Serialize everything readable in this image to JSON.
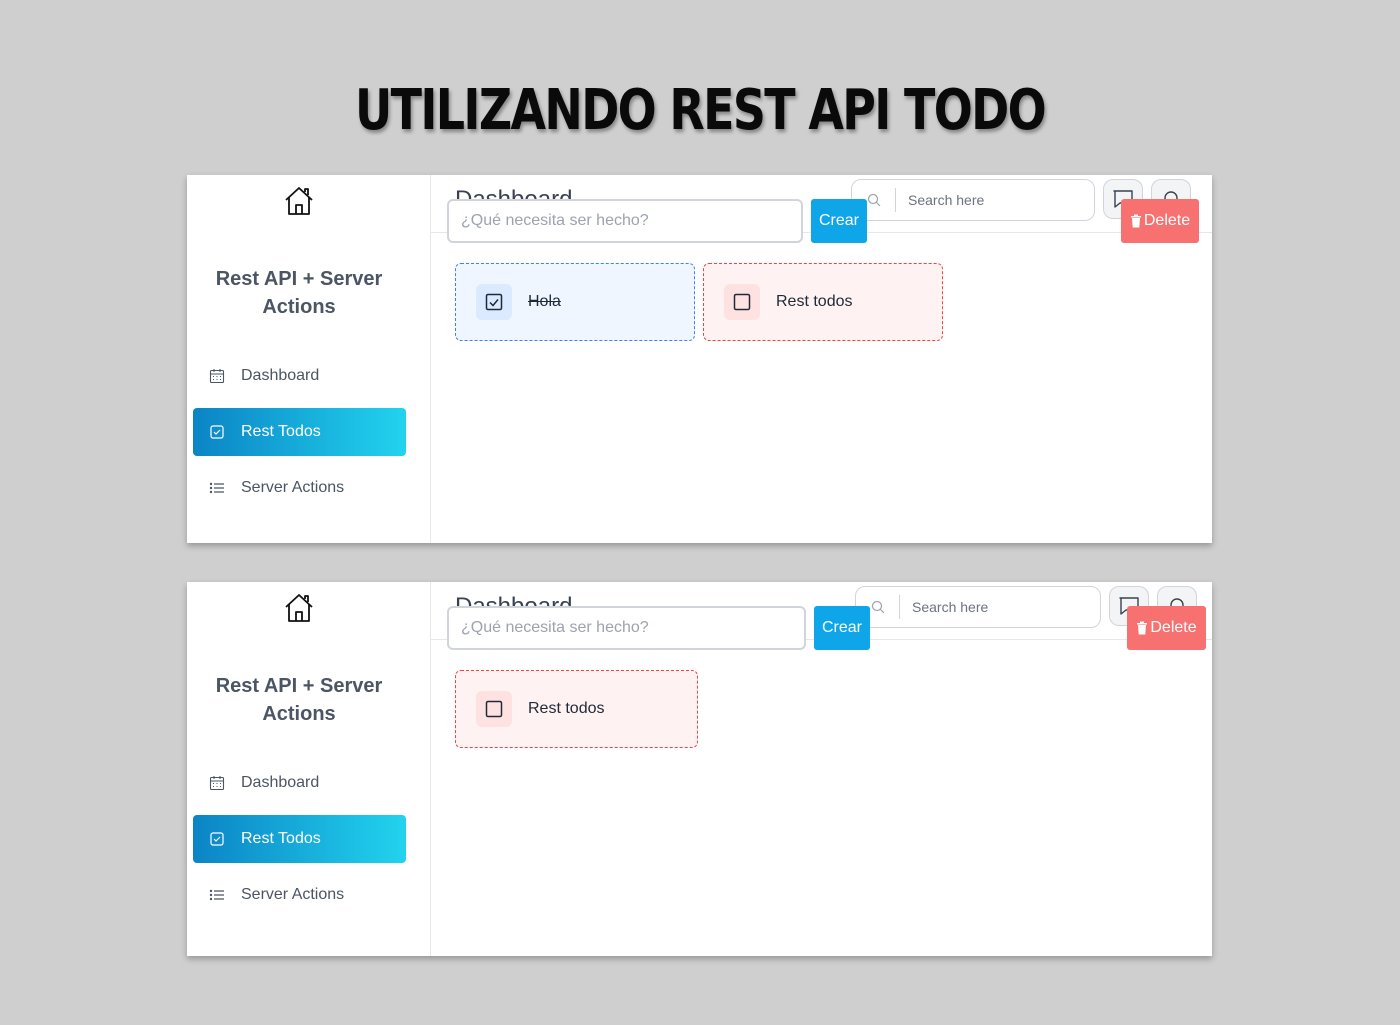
{
  "heading": "UTILIZANDO REST API TODO",
  "screens": [
    {
      "sidebar": {
        "brand": "Rest API + Server Actions",
        "items": [
          {
            "label": "Dashboard",
            "icon": "calendar-icon",
            "active": false
          },
          {
            "label": "Rest Todos",
            "icon": "check-square-icon",
            "active": true
          },
          {
            "label": "Server Actions",
            "icon": "list-icon",
            "active": false
          }
        ]
      },
      "header": {
        "title": "Dashboard",
        "search_placeholder": "Search here"
      },
      "form": {
        "input_placeholder": "¿Qué necesita ser hecho?",
        "create_label": "Crear",
        "delete_label": "Delete"
      },
      "todos": [
        {
          "text": "Hola",
          "completed": true
        },
        {
          "text": "Rest todos",
          "completed": false
        }
      ]
    },
    {
      "sidebar": {
        "brand": "Rest API + Server Actions",
        "items": [
          {
            "label": "Dashboard",
            "icon": "calendar-icon",
            "active": false
          },
          {
            "label": "Rest Todos",
            "icon": "check-square-icon",
            "active": true
          },
          {
            "label": "Server Actions",
            "icon": "list-icon",
            "active": false
          }
        ]
      },
      "header": {
        "title": "Dashboard",
        "search_placeholder": "Search here"
      },
      "form": {
        "input_placeholder": "¿Qué necesita ser hecho?",
        "create_label": "Crear",
        "delete_label": "Delete"
      },
      "todos": [
        {
          "text": "Rest todos",
          "completed": false
        }
      ]
    }
  ],
  "colors": {
    "accent_gradient_start": "#0b84c5",
    "accent_gradient_end": "#22d3ee",
    "create_button": "#0ea5e9",
    "delete_button": "#f87171",
    "completed_card": "#eff6ff",
    "pending_card": "#fef2f2"
  }
}
